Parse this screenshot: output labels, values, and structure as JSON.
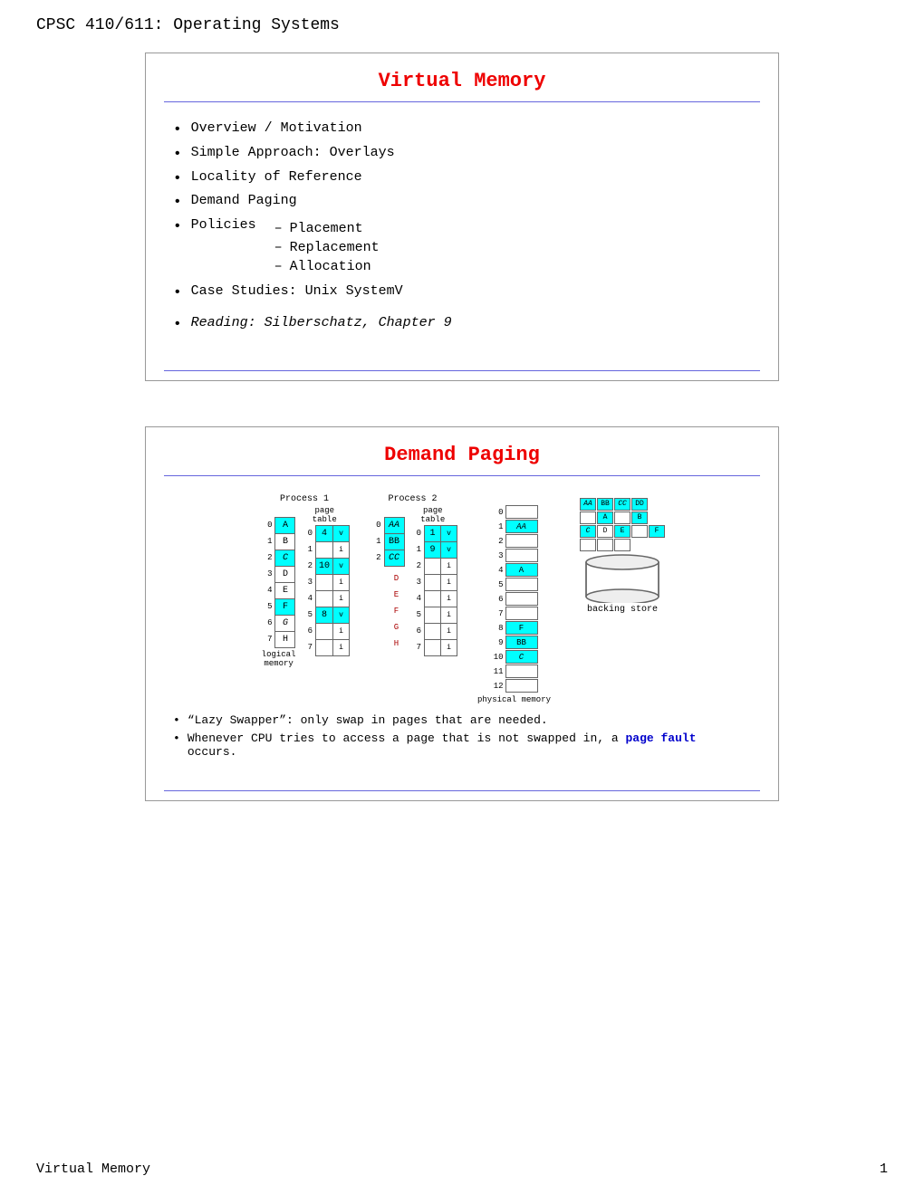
{
  "header": {
    "title": "CPSC 410/611: Operating Systems"
  },
  "footer": {
    "left": "Virtual Memory",
    "right": "1"
  },
  "slide1": {
    "title": "Virtual Memory",
    "bullets": [
      "Overview / Motivation",
      "Simple Approach: Overlays",
      "Locality of Reference",
      "Demand Paging",
      "Policies",
      "Case Studies: Unix SystemV"
    ],
    "sub_bullets": [
      "Placement",
      "Replacement",
      "Allocation"
    ],
    "reading": "Reading: Silberschatz, Chapter 9"
  },
  "slide2": {
    "title": "Demand Paging",
    "note1": "“Lazy Swapper”: only swap in pages that are needed.",
    "note2_prefix": "Whenever CPU tries to access a page that is not swapped in, a ",
    "note2_link": "page fault",
    "note2_suffix": " occurs.",
    "process1_label": "Process 1",
    "process2_label": "Process 2",
    "page_table_label": "page table",
    "logical_memory": "logical memory",
    "physical_memory": "physical memory",
    "backing_store": "backing store"
  }
}
